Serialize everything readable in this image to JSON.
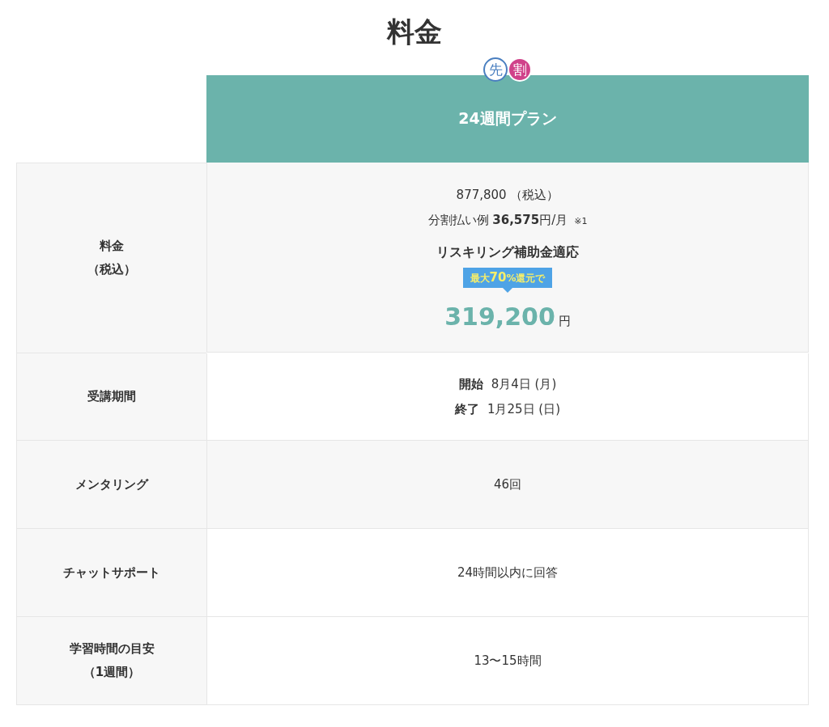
{
  "title": "料金",
  "plan": {
    "badges": [
      {
        "text": "先",
        "color": "#4a7fc0"
      },
      {
        "text": "割",
        "color": "#d0428a"
      }
    ],
    "name": "24週間プラン"
  },
  "rows": [
    {
      "kind": "price",
      "label_lines": [
        "料金",
        "（税込）"
      ],
      "price": "877,800 （税込）",
      "installment": "分割払い例 **36,575**円/月",
      "note": "※1",
      "subsidy_heading": "リスキリング補助金適応",
      "callout": "最大**70**%還元で",
      "subsidy_price": "319,200",
      "subsidy_unit": "円"
    },
    {
      "kind": "period",
      "label_lines": [
        "受講期間"
      ],
      "items": [
        {
          "label": "開始",
          "value": "8月4日 (月)"
        },
        {
          "label": "終了",
          "value": "1月25日 (日)"
        }
      ]
    },
    {
      "kind": "text",
      "label_lines": [
        "メンタリング"
      ],
      "value": "46回"
    },
    {
      "kind": "text",
      "label_lines": [
        "チャットサポート"
      ],
      "value": "24時間以内に回答"
    },
    {
      "kind": "text",
      "label_lines": [
        "学習時間の目安",
        "（1週間）"
      ],
      "value": "13〜15時間"
    }
  ]
}
